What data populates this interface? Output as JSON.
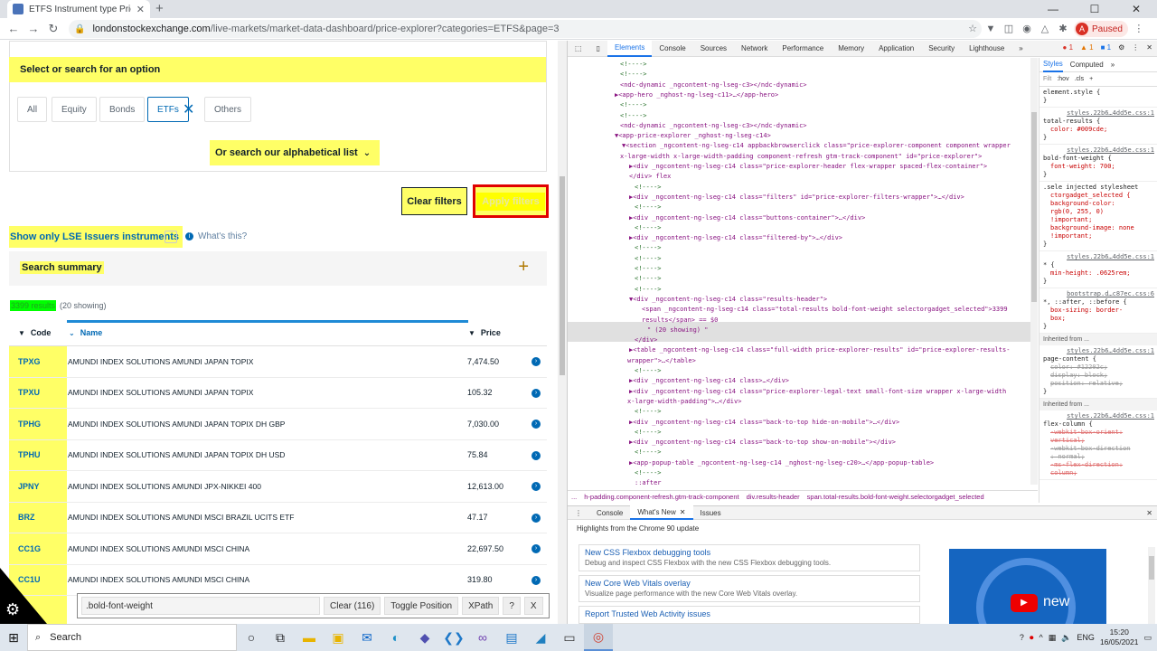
{
  "browser": {
    "tab_title": "ETFS Instrument type Price explo...",
    "url_domain": "londonstockexchange.com",
    "url_path": "/live-markets/market-data-dashboard/price-explorer?categories=ETFS&page=3",
    "profile_initial": "A",
    "profile_status": "Paused"
  },
  "page": {
    "select_prompt": "Select or search for an option",
    "categories": [
      {
        "label": "All"
      },
      {
        "label": "Equity"
      },
      {
        "label": "Bonds"
      },
      {
        "label": "ETFs"
      },
      {
        "label": "Others"
      }
    ],
    "alphabetical_label": "Or search our alphabetical list",
    "clear_filters": "Clear filters",
    "apply_filters": "Apply filters",
    "lse_only": "Show only LSE Issuers instruments",
    "whats_this": "What's this?",
    "search_summary": "Search summary",
    "results_count": "3399 results",
    "results_showing": "(20 showing)",
    "columns": {
      "code": "Code",
      "name": "Name",
      "price": "Price"
    },
    "rows": [
      {
        "code": "TPXG",
        "name": "AMUNDI INDEX SOLUTIONS AMUNDI JAPAN TOPIX",
        "price": "7,474.50"
      },
      {
        "code": "TPXU",
        "name": "AMUNDI INDEX SOLUTIONS AMUNDI JAPAN TOPIX",
        "price": "105.32"
      },
      {
        "code": "TPHG",
        "name": "AMUNDI INDEX SOLUTIONS AMUNDI JAPAN TOPIX DH GBP",
        "price": "7,030.00"
      },
      {
        "code": "TPHU",
        "name": "AMUNDI INDEX SOLUTIONS AMUNDI JAPAN TOPIX DH USD",
        "price": "75.84"
      },
      {
        "code": "JPNY",
        "name": "AMUNDI INDEX SOLUTIONS AMUNDI JPX-NIKKEI 400",
        "price": "12,613.00"
      },
      {
        "code": "BRZ",
        "name": "AMUNDI INDEX SOLUTIONS AMUNDI MSCI BRAZIL UCITS ETF",
        "price": "47.17"
      },
      {
        "code": "CC1G",
        "name": "AMUNDI INDEX SOLUTIONS AMUNDI MSCI CHINA",
        "price": "22,697.50"
      },
      {
        "code": "CC1U",
        "name": "AMUNDI INDEX SOLUTIONS AMUNDI MSCI CHINA",
        "price": "319.80"
      }
    ]
  },
  "selector_gadget": {
    "query": ".bold-font-weight",
    "clear": "Clear (116)",
    "toggle_position": "Toggle Position",
    "xpath": "XPath",
    "help": "?",
    "close": "X"
  },
  "devtools": {
    "tabs": [
      "Elements",
      "Console",
      "Sources",
      "Network",
      "Performance",
      "Memory",
      "Application",
      "Security",
      "Lighthouse"
    ],
    "errors": "1",
    "warnings": "1",
    "info": "1",
    "dom_lines": [
      {
        "t": "<!---->"
      },
      {
        "t": "<!---->"
      },
      {
        "t": "<ndc-dynamic _ngcontent-ng-lseg-c3></ndc-dynamic>"
      },
      {
        "t": "▶<app-hero _nghost-ng-lseg-c11>…</app-hero>"
      },
      {
        "t": "<!---->"
      },
      {
        "t": "<!---->"
      },
      {
        "t": "<ndc-dynamic _ngcontent-ng-lseg-c3></ndc-dynamic>"
      },
      {
        "t": "▼<app-price-explorer _nghost-ng-lseg-c14>"
      },
      {
        "t": "▼<section _ngcontent-ng-lseg-c14 appbackbrowserclick class=\"price-explorer-component component wrapper"
      },
      {
        "t": "x-large-width x-large-width-padding component-refresh gtm-track-component\" id=\"price-explorer\">"
      },
      {
        "t": "▶<div _ngcontent-ng-lseg-c14 class=\"price-explorer-header flex-wrapper spaced-flex-container\">"
      },
      {
        "t": "</div>  flex"
      },
      {
        "t": "<!---->"
      },
      {
        "t": "▶<div _ngcontent-ng-lseg-c14 class=\"filters\" id=\"price-explorer-filters-wrapper\">…</div>"
      },
      {
        "t": "<!---->"
      },
      {
        "t": "▶<div _ngcontent-ng-lseg-c14 class=\"buttons-container\">…</div>"
      },
      {
        "t": "<!---->"
      },
      {
        "t": "▶<div _ngcontent-ng-lseg-c14 class=\"filtered-by\">…</div>"
      },
      {
        "t": "<!---->"
      },
      {
        "t": "<!---->"
      },
      {
        "t": "<!---->"
      },
      {
        "t": "<!---->"
      },
      {
        "t": "<!---->"
      },
      {
        "t": "▼<div _ngcontent-ng-lseg-c14 class=\"results-header\">"
      },
      {
        "t": "<span _ngcontent-ng-lseg-c14 class=\"total-results bold-font-weight selectorgadget_selected\">3399"
      },
      {
        "t": "results</span> == $0"
      },
      {
        "t": "\" (20 showing) \""
      },
      {
        "t": "</div>"
      },
      {
        "t": "▶<table _ngcontent-ng-lseg-c14 class=\"full-width price-explorer-results\" id=\"price-explorer-results-"
      },
      {
        "t": "wrapper\">…</table>"
      },
      {
        "t": "<!---->"
      },
      {
        "t": "▶<div _ngcontent-ng-lseg-c14 class>…</div>"
      },
      {
        "t": "▶<div _ngcontent-ng-lseg-c14 class=\"price-explorer-legal-text small-font-size wrapper x-large-width"
      },
      {
        "t": "x-large-width-padding\">…</div>"
      },
      {
        "t": "<!---->"
      },
      {
        "t": "▶<div _ngcontent-ng-lseg-c14 class=\"back-to-top hide-on-mobile\">…</div>"
      },
      {
        "t": "<!---->"
      },
      {
        "t": "▶<div _ngcontent-ng-lseg-c14 class=\"back-to-top show-on-mobile\"></div>"
      },
      {
        "t": "<!---->"
      },
      {
        "t": "▶<app-popup-table _ngcontent-ng-lseg-c14 _nghost-ng-lseg-c20>…</app-popup-table>"
      },
      {
        "t": "<!---->"
      },
      {
        "t": "::after"
      }
    ],
    "breadcrumbs": [
      "...",
      "h-padding.component-refresh.gtm-track-component",
      "div.results-header",
      "span.total-results.bold-font-weight.selectorgadget_selected"
    ],
    "styles_tabs": [
      "Styles",
      "Computed"
    ],
    "styles_filter": "Filt",
    "styles_hov": ":hov",
    "styles_cls": ".cls",
    "style_rules": [
      {
        "sel": "element.style {",
        "src": "",
        "props": [
          "}"
        ]
      },
      {
        "sel": "total-results {",
        "src": "styles.22b6…4dd5e.css:1",
        "props": [
          "color: #009cde;",
          "}"
        ]
      },
      {
        "sel": "bold-font-weight {",
        "src": "styles.22b6…4dd5e.css:1",
        "props": [
          "font-weight: 700;",
          "}"
        ]
      },
      {
        "sel": ".sele  injected stylesheet",
        "src": "",
        "props": [
          "ctorgadget_selected {",
          "background-color:",
          "rgb(0, 255, 0)",
          "!important;",
          "background-image: none",
          "!important;",
          "}"
        ]
      },
      {
        "sel": "* {",
        "src": "styles.22b6…4dd5e.css:1",
        "props": [
          "min-height: .0625rem;",
          "}"
        ]
      },
      {
        "sel": "*, ::after, ::before {",
        "src": "bootstrap.d…c87ec.css:6",
        "props": [
          "box-sizing: border-",
          "box;",
          "}"
        ]
      }
    ],
    "inherited_1": "Inherited from ...",
    "inherited_1_rule": {
      "sel": "page-content {",
      "src": "styles.22b6…4dd5e.css:1",
      "props": [
        "color: #12202c;",
        "display: block;",
        "position: relative;",
        "}"
      ]
    },
    "inherited_2": "Inherited from ...",
    "inherited_2_rule": {
      "sel": "flex-column {",
      "src": "styles.22b6…4dd5e.css:1",
      "props": [
        "-webkit-box-orient:",
        "vertical;",
        "-webkit-box-direction",
        ": normal;",
        "-ms-flex-direction:",
        "column;"
      ]
    },
    "drawer_tabs": [
      "Console",
      "What's New",
      "Issues"
    ],
    "highlights": "Highlights from the Chrome 90 update",
    "whats_new": [
      {
        "title": "New CSS Flexbox debugging tools",
        "desc": "Debug and inspect CSS Flexbox with the new CSS Flexbox debugging tools."
      },
      {
        "title": "New Core Web Vitals overlay",
        "desc": "Visualize page performance with the new Core Web Vitals overlay."
      },
      {
        "title": "Report Trusted Web Activity issues",
        "desc": ""
      }
    ],
    "video_text": "new"
  },
  "taskbar": {
    "search": "Search",
    "lang": "ENG",
    "time": "15:20",
    "date": "16/05/2021"
  },
  "colors": {
    "highlight_yellow": "#ffff66",
    "lse_blue": "#0069b4",
    "selected_green": "#00ff00",
    "apply_border": "#e00000"
  }
}
